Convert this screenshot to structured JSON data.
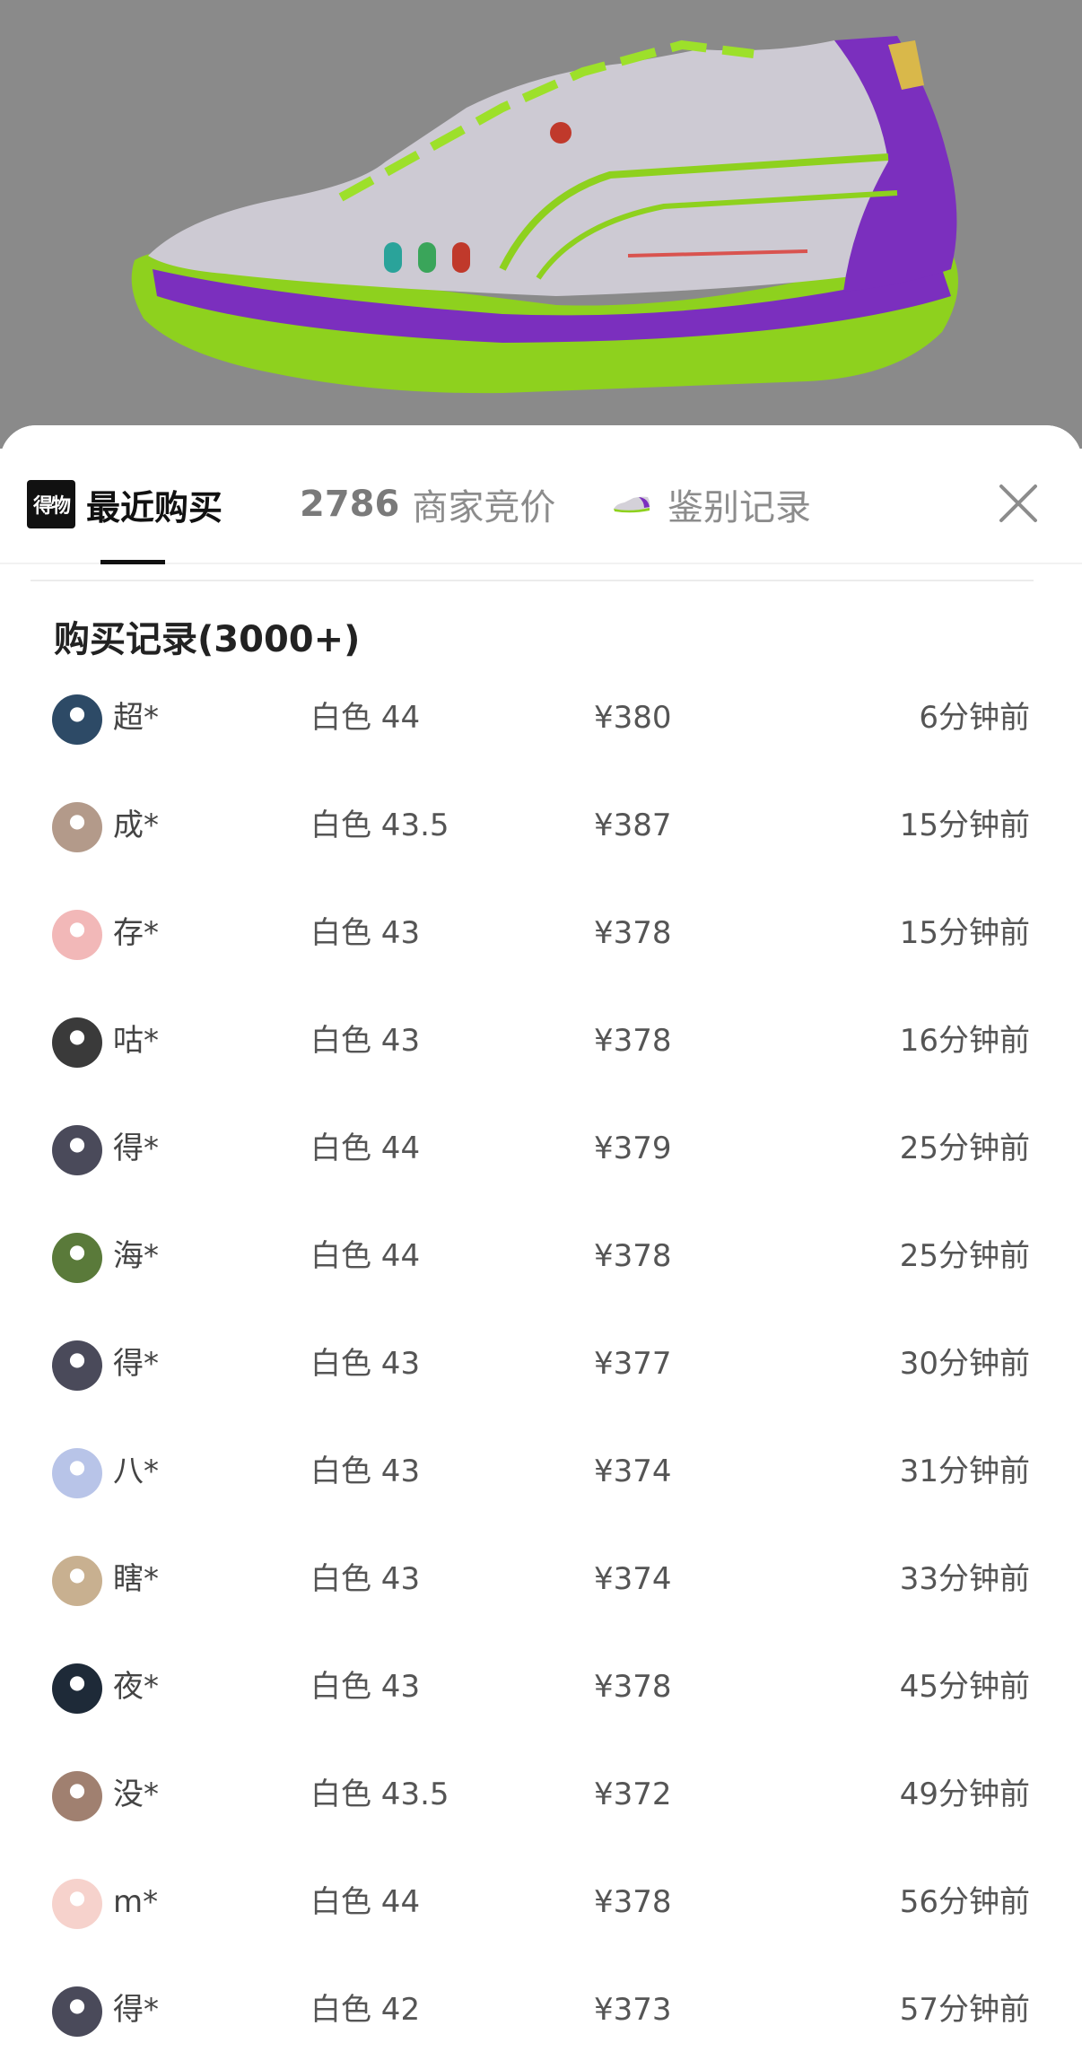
{
  "header": {
    "tabs": [
      {
        "label": "最近购买",
        "logo": "得物",
        "active": true
      },
      {
        "count": "2786",
        "label": "商家竞价"
      },
      {
        "label": "鉴别记录",
        "icon": "shoe-thumbnail-icon"
      }
    ],
    "close_icon": "close-icon"
  },
  "records": {
    "title": "购买记录(3000+)",
    "rows": [
      {
        "user": "超*",
        "size": "白色 44",
        "price": "¥380",
        "time": "6分钟前",
        "avatar_color": "#2d4a66"
      },
      {
        "user": "成*",
        "size": "白色 43.5",
        "price": "¥387",
        "time": "15分钟前",
        "avatar_color": "#b39a8a"
      },
      {
        "user": "存*",
        "size": "白色 43",
        "price": "¥378",
        "time": "15分钟前",
        "avatar_color": "#f2b8b8"
      },
      {
        "user": "咕*",
        "size": "白色 43",
        "price": "¥378",
        "time": "16分钟前",
        "avatar_color": "#3a3a3a"
      },
      {
        "user": "得*",
        "size": "白色 44",
        "price": "¥379",
        "time": "25分钟前",
        "avatar_color": "#4a4a5a"
      },
      {
        "user": "海*",
        "size": "白色 44",
        "price": "¥378",
        "time": "25分钟前",
        "avatar_color": "#5a7a3a"
      },
      {
        "user": "得*",
        "size": "白色 43",
        "price": "¥377",
        "time": "30分钟前",
        "avatar_color": "#4a4a5a"
      },
      {
        "user": "八*",
        "size": "白色 43",
        "price": "¥374",
        "time": "31分钟前",
        "avatar_color": "#b8c4e8"
      },
      {
        "user": "瞎*",
        "size": "白色 43",
        "price": "¥374",
        "time": "33分钟前",
        "avatar_color": "#c8b090"
      },
      {
        "user": "夜*",
        "size": "白色 43",
        "price": "¥378",
        "time": "45分钟前",
        "avatar_color": "#1e2a38"
      },
      {
        "user": "没*",
        "size": "白色 43.5",
        "price": "¥372",
        "time": "49分钟前",
        "avatar_color": "#a08070"
      },
      {
        "user": "m*",
        "size": "白色 44",
        "price": "¥378",
        "time": "56分钟前",
        "avatar_color": "#f6d2cc"
      },
      {
        "user": "得*",
        "size": "白色 42",
        "price": "¥373",
        "time": "57分钟前",
        "avatar_color": "#4a4a5a"
      }
    ]
  },
  "colors": {
    "backdrop": "#8a8a8a",
    "shoe_upper": "#c9c6cf",
    "shoe_purple": "#7b2fbe",
    "shoe_green": "#8ed11e",
    "text_primary": "#111111",
    "text_secondary": "#555555"
  }
}
